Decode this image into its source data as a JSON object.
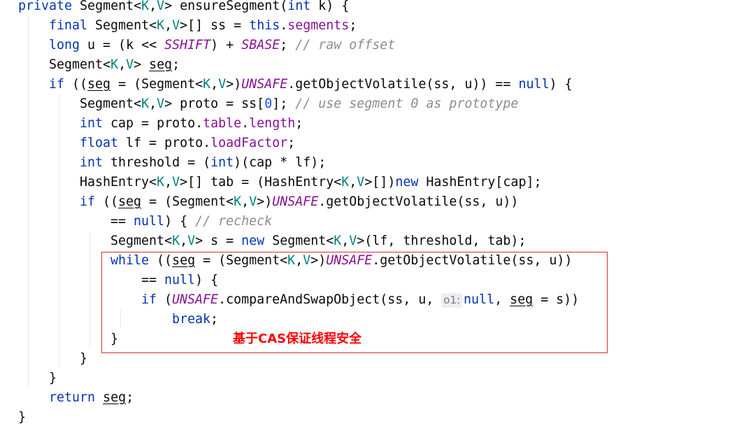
{
  "code": {
    "lines": [
      [
        {
          "t": "private",
          "c": "kw"
        },
        {
          "t": " Segment<"
        },
        {
          "t": "K",
          "c": "tp"
        },
        {
          "t": ","
        },
        {
          "t": "V",
          "c": "tp"
        },
        {
          "t": "> ensureSegment("
        },
        {
          "t": "int",
          "c": "kw"
        },
        {
          "t": " k) {"
        }
      ],
      [
        {
          "t": "final",
          "c": "kw"
        },
        {
          "t": " Segment<"
        },
        {
          "t": "K",
          "c": "tp"
        },
        {
          "t": ","
        },
        {
          "t": "V",
          "c": "tp"
        },
        {
          "t": ">[] ss = "
        },
        {
          "t": "this",
          "c": "kw"
        },
        {
          "t": "."
        },
        {
          "t": "segments",
          "c": "fld"
        },
        {
          "t": ";"
        }
      ],
      [
        {
          "t": "long",
          "c": "kw"
        },
        {
          "t": " u = (k << "
        },
        {
          "t": "SSHIFT",
          "c": "cst"
        },
        {
          "t": ") + "
        },
        {
          "t": "SBASE",
          "c": "cst"
        },
        {
          "t": "; "
        },
        {
          "t": "// raw offset",
          "c": "cmt"
        }
      ],
      [
        {
          "t": "Segment<"
        },
        {
          "t": "K",
          "c": "tp"
        },
        {
          "t": ","
        },
        {
          "t": "V",
          "c": "tp"
        },
        {
          "t": "> "
        },
        {
          "t": "seg",
          "c": "var"
        },
        {
          "t": ";"
        }
      ],
      [
        {
          "t": "if",
          "c": "kw"
        },
        {
          "t": " (("
        },
        {
          "t": "seg",
          "c": "var"
        },
        {
          "t": " = (Segment<"
        },
        {
          "t": "K",
          "c": "tp"
        },
        {
          "t": ","
        },
        {
          "t": "V",
          "c": "tp"
        },
        {
          "t": ">)"
        },
        {
          "t": "UNSAFE",
          "c": "cst"
        },
        {
          "t": ".getObjectVolatile(ss, u)) == "
        },
        {
          "t": "null",
          "c": "kw"
        },
        {
          "t": ") {"
        }
      ],
      [
        {
          "t": "Segment<"
        },
        {
          "t": "K",
          "c": "tp"
        },
        {
          "t": ","
        },
        {
          "t": "V",
          "c": "tp"
        },
        {
          "t": "> proto = ss["
        },
        {
          "t": "0",
          "c": "num"
        },
        {
          "t": "]; "
        },
        {
          "t": "// use segment 0 as prototype",
          "c": "cmt"
        }
      ],
      [
        {
          "t": "int",
          "c": "kw"
        },
        {
          "t": " cap = proto."
        },
        {
          "t": "table",
          "c": "fld"
        },
        {
          "t": "."
        },
        {
          "t": "length",
          "c": "fld"
        },
        {
          "t": ";"
        }
      ],
      [
        {
          "t": "float",
          "c": "kw"
        },
        {
          "t": " lf = proto."
        },
        {
          "t": "loadFactor",
          "c": "fld"
        },
        {
          "t": ";"
        }
      ],
      [
        {
          "t": "int",
          "c": "kw"
        },
        {
          "t": " threshold = ("
        },
        {
          "t": "int",
          "c": "kw"
        },
        {
          "t": ")(cap * lf);"
        }
      ],
      [
        {
          "t": "HashEntry<"
        },
        {
          "t": "K",
          "c": "tp"
        },
        {
          "t": ","
        },
        {
          "t": "V",
          "c": "tp"
        },
        {
          "t": ">[] tab = (HashEntry<"
        },
        {
          "t": "K",
          "c": "tp"
        },
        {
          "t": ","
        },
        {
          "t": "V",
          "c": "tp"
        },
        {
          "t": ">[])"
        },
        {
          "t": "new",
          "c": "kw"
        },
        {
          "t": " HashEntry[cap];"
        }
      ],
      [
        {
          "t": "if",
          "c": "kw"
        },
        {
          "t": " (("
        },
        {
          "t": "seg",
          "c": "var"
        },
        {
          "t": " = (Segment<"
        },
        {
          "t": "K",
          "c": "tp"
        },
        {
          "t": ","
        },
        {
          "t": "V",
          "c": "tp"
        },
        {
          "t": ">)"
        },
        {
          "t": "UNSAFE",
          "c": "cst"
        },
        {
          "t": ".getObjectVolatile(ss, u))"
        }
      ],
      [
        {
          "t": "== "
        },
        {
          "t": "null",
          "c": "kw"
        },
        {
          "t": ") { "
        },
        {
          "t": "// recheck",
          "c": "cmt"
        }
      ],
      [
        {
          "t": "Segment<"
        },
        {
          "t": "K",
          "c": "tp"
        },
        {
          "t": ","
        },
        {
          "t": "V",
          "c": "tp"
        },
        {
          "t": "> s = "
        },
        {
          "t": "new",
          "c": "kw"
        },
        {
          "t": " Segment<"
        },
        {
          "t": "K",
          "c": "tp"
        },
        {
          "t": ","
        },
        {
          "t": "V",
          "c": "tp"
        },
        {
          "t": ">(lf, threshold, tab);"
        }
      ],
      [
        {
          "t": "while",
          "c": "kw"
        },
        {
          "t": " (("
        },
        {
          "t": "seg",
          "c": "var"
        },
        {
          "t": " = (Segment<"
        },
        {
          "t": "K",
          "c": "tp"
        },
        {
          "t": ","
        },
        {
          "t": "V",
          "c": "tp"
        },
        {
          "t": ">)"
        },
        {
          "t": "UNSAFE",
          "c": "cst"
        },
        {
          "t": ".getObjectVolatile(ss, u))"
        }
      ],
      [
        {
          "t": "== "
        },
        {
          "t": "null",
          "c": "kw"
        },
        {
          "t": ") {"
        }
      ],
      [
        {
          "t": "if",
          "c": "kw"
        },
        {
          "t": " ("
        },
        {
          "t": "UNSAFE",
          "c": "cst"
        },
        {
          "t": ".compareAndSwapObject(ss, u, "
        },
        {
          "t": "o1:",
          "c": "hint"
        },
        {
          "t": "null",
          "c": "kw"
        },
        {
          "t": ", "
        },
        {
          "t": "seg",
          "c": "var"
        },
        {
          "t": " = s))"
        }
      ],
      [
        {
          "t": "break",
          "c": "kw"
        },
        {
          "t": ";"
        }
      ],
      [
        {
          "t": "}"
        }
      ],
      [
        {
          "t": "}"
        }
      ],
      [
        {
          "t": "}"
        }
      ],
      [
        {
          "t": "return",
          "c": "kw"
        },
        {
          "t": " "
        },
        {
          "t": "seg",
          "c": "var"
        },
        {
          "t": ";"
        }
      ],
      [
        {
          "t": "}"
        }
      ]
    ]
  },
  "annotation": {
    "text": "基于CAS保证线程安全",
    "color": "#ff0000"
  },
  "colors": {
    "keyword": "#0033b3",
    "type_param": "#008080",
    "field": "#871094",
    "comment": "#8c8c8c",
    "number": "#1750eb",
    "highlight_border": "#d32f2f"
  }
}
